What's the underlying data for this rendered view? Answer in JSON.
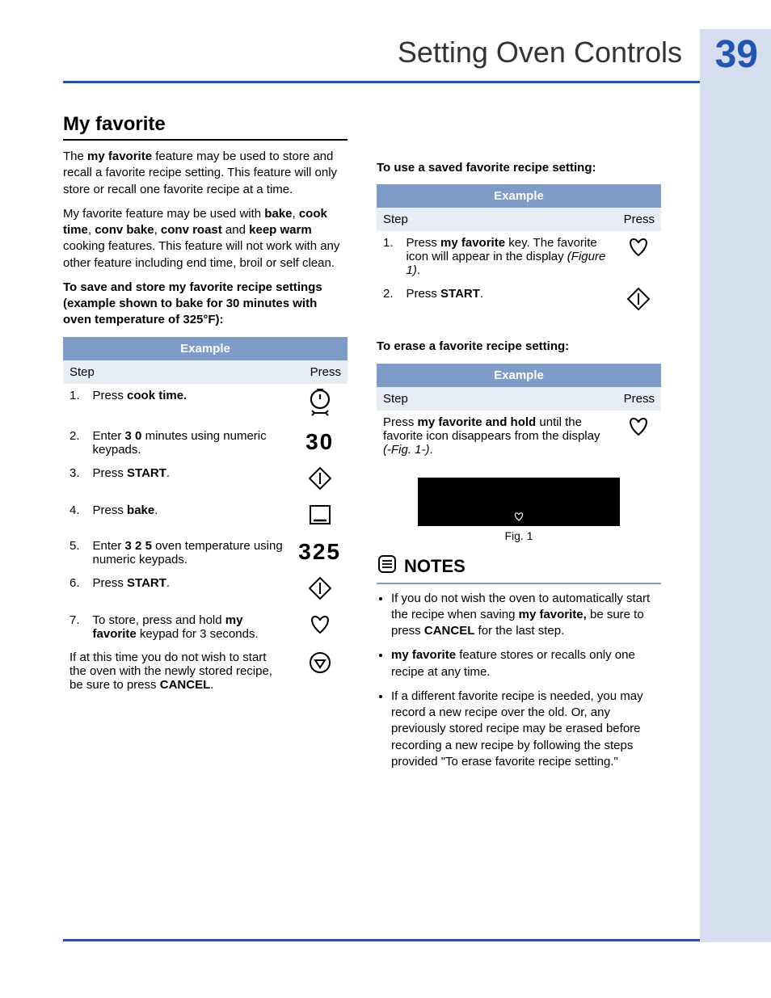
{
  "page": {
    "title": "Setting Oven Controls",
    "number": "39"
  },
  "section_heading": "My favorite",
  "intro": {
    "p1_a": "The ",
    "p1_b": "my favorite",
    "p1_c": " feature may be used to store and recall a favorite recipe setting. This feature will only store or recall one favorite recipe at a time.",
    "p2_a": "My favorite feature may be used with ",
    "p2_b": "bake",
    "p2_c": ", ",
    "p2_d": "cook time",
    "p2_e": ", ",
    "p2_f": "conv bake",
    "p2_g": ", ",
    "p2_h": "conv roast",
    "p2_i": " and ",
    "p2_j": "keep warm",
    "p2_k": " cooking features. This feature will not work with any other feature including end time, broil or self clean."
  },
  "save_instructions_heading": "To save and store my favorite recipe settings (example shown to bake for 30 minutes with oven temperature of 325°F):",
  "table_labels": {
    "example": "Example",
    "step": "Step",
    "press": "Press"
  },
  "save_steps": [
    {
      "n": "1.",
      "pre": "Press ",
      "bold": "cook time.",
      "post": "",
      "icon": "cooktime"
    },
    {
      "n": "2.",
      "pre": "Enter ",
      "bold": "3 0",
      "post": " minutes using numeric keypads.",
      "icon": "30"
    },
    {
      "n": "3.",
      "pre": "Press ",
      "bold": "START",
      "post": ".",
      "icon": "start"
    },
    {
      "n": "4.",
      "pre": "Press ",
      "bold": "bake",
      "post": ".",
      "icon": "bake"
    },
    {
      "n": "5.",
      "pre": "Enter ",
      "bold": "3 2 5",
      "post": " oven temperature using numeric keypads.",
      "icon": "325"
    },
    {
      "n": "6.",
      "pre": "Press ",
      "bold": "START",
      "post": ".",
      "icon": "start"
    },
    {
      "n": "7.",
      "pre": "To store, press and hold ",
      "bold": "my favorite",
      "post": " keypad for 3 seconds.",
      "icon": "heart"
    }
  ],
  "save_footer": {
    "a": "If at this time you do not wish to start the oven with the newly stored recipe, be sure to press ",
    "b": "CANCEL",
    "c": ".",
    "icon": "cancel"
  },
  "use_heading": "To use a saved favorite recipe setting:",
  "use_steps": [
    {
      "n": "1.",
      "pre": "Press ",
      "bold": "my favorite",
      "post": " key. The favorite icon will appear in the display ",
      "ital": "(Figure 1)",
      "post2": ".",
      "icon": "heart"
    },
    {
      "n": "2.",
      "pre": "Press ",
      "bold": "START",
      "post": ".",
      "icon": "start"
    }
  ],
  "erase_heading": "To erase a favorite recipe setting:",
  "erase_row": {
    "a": "Press ",
    "b": "my favorite and hold",
    "c": " until the favorite icon disappears from the display ",
    "d": "(-Fig. 1-)",
    "e": ".",
    "icon": "heart"
  },
  "fig_caption": "Fig. 1",
  "notes_heading": "NOTES",
  "notes": [
    {
      "a": "If you do not wish the oven to automatically start the recipe when saving ",
      "b": "my favorite,",
      "c": " be sure to press ",
      "d": "CANCEL",
      "e": " for the last step."
    },
    {
      "a": "",
      "b": "my favorite",
      "c": " feature stores or recalls only one recipe at any time.",
      "d": "",
      "e": ""
    },
    {
      "a": "If a different favorite recipe is needed, you may record a new recipe over the old. Or, any previously stored recipe may be erased before recording a new recipe by following the steps provided \"To erase favorite recipe setting.\"",
      "b": "",
      "c": "",
      "d": "",
      "e": ""
    }
  ]
}
